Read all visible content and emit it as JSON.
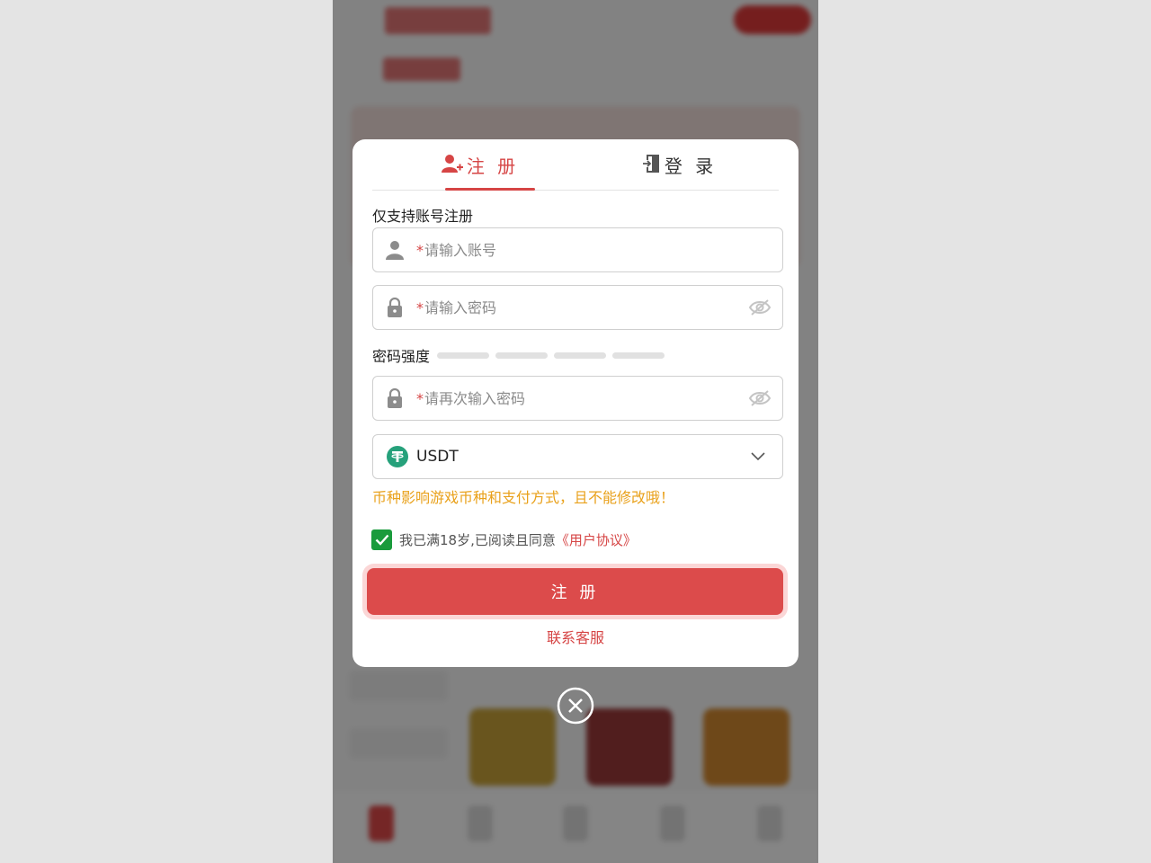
{
  "tabs": {
    "register": "注 册",
    "login": "登 录"
  },
  "hint": "仅支持账号注册",
  "fields": {
    "required_mark": "*",
    "account_placeholder": "请输入账号",
    "password_placeholder": "请输入密码",
    "confirm_placeholder": "请再次输入密码"
  },
  "strength": {
    "label": "密码强度",
    "filled_segments": 0,
    "total_segments": 4
  },
  "currency": {
    "selected": "USDT",
    "warning": "币种影响游戏币种和支付方式，且不能修改哦！"
  },
  "agreement": {
    "checked": true,
    "text": "我已满18岁,已阅读且同意",
    "link": "《用户协议》"
  },
  "submit_label": "注 册",
  "support_link": "联系客服",
  "colors": {
    "accent": "#d64545",
    "warning": "#e9a11b",
    "check": "#1a9b3c",
    "usdt": "#26a17b"
  },
  "icons": [
    "user-add-icon",
    "login-door-icon",
    "user-icon",
    "lock-icon",
    "eye-off-icon",
    "usdt-icon",
    "chevron-down-icon",
    "checkmark-icon",
    "close-circle-icon"
  ]
}
